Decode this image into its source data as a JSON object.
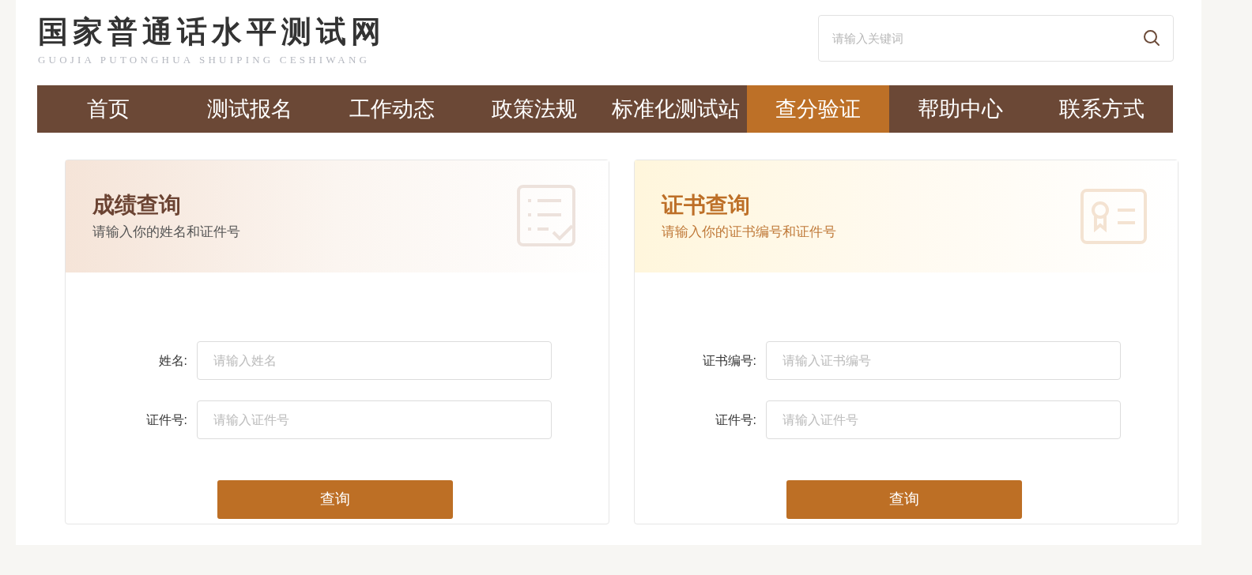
{
  "logo": {
    "title": "国家普通话水平测试网",
    "subtitle": "GUOJIA PUTONGHUA SHUIPING CESHIWANG"
  },
  "search": {
    "placeholder": "请输入关键词"
  },
  "nav": [
    {
      "label": "首页",
      "selected": false
    },
    {
      "label": "测试报名",
      "selected": false
    },
    {
      "label": "工作动态",
      "selected": false
    },
    {
      "label": "政策法规",
      "selected": false
    },
    {
      "label": "标准化测试站",
      "selected": false
    },
    {
      "label": "查分验证",
      "selected": true
    },
    {
      "label": "帮助中心",
      "selected": false
    },
    {
      "label": "联系方式",
      "selected": false
    }
  ],
  "cards": [
    {
      "kind": "score",
      "title": "成绩查询",
      "subtitle": "请输入你的姓名和证件号",
      "fields": [
        {
          "label": "姓名:",
          "placeholder": "请输入姓名"
        },
        {
          "label": "证件号:",
          "placeholder": "请输入证件号"
        }
      ],
      "button": "查询"
    },
    {
      "kind": "certificate",
      "title": "证书查询",
      "subtitle": "请输入你的证书编号和证件号",
      "fields": [
        {
          "label": "证书编号:",
          "placeholder": "请输入证书编号"
        },
        {
          "label": "证件号:",
          "placeholder": "请输入证件号"
        }
      ],
      "button": "查询"
    }
  ]
}
